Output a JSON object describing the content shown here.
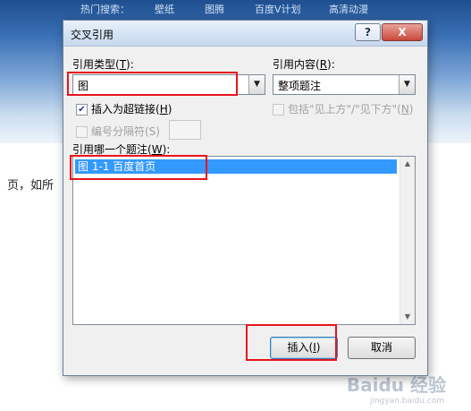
{
  "background": {
    "nav": [
      "热门搜索：",
      "壁纸",
      "图腾",
      "百度V计划",
      "高清动漫"
    ],
    "body_text": "页，如所"
  },
  "watermark": {
    "brand": "Baidu 经验",
    "url": "jingyan.baidu.com"
  },
  "dialog": {
    "title": "交叉引用",
    "help_button": "?",
    "close_button": "X",
    "reference_type": {
      "label_prefix": "引用类型(",
      "label_key": "T",
      "label_suffix": "):",
      "value": "图"
    },
    "reference_content": {
      "label_prefix": "引用内容(",
      "label_key": "R",
      "label_suffix": "):",
      "value": "整项题注"
    },
    "insert_hyperlink": {
      "label_prefix": "插入为超链接(",
      "label_key": "H",
      "label_suffix": ")",
      "checked": true
    },
    "include_above_below": {
      "label_prefix": "包括\"见上方\"/\"见下方\"(",
      "label_key": "N",
      "label_suffix": ")",
      "checked": false
    },
    "separate_numbers": {
      "label": "编号分隔符(S)",
      "checked": false
    },
    "for_which_caption": {
      "label_prefix": "引用哪一个题注(",
      "label_key": "W",
      "label_suffix": "):"
    },
    "captions": [
      "图 1-1 百度首页"
    ],
    "insert_button": {
      "label_prefix": "插入(",
      "label_key": "I",
      "label_suffix": ")"
    },
    "cancel_button": "取消"
  },
  "colors": {
    "highlight": "#e8141c",
    "selection": "#3399ff"
  }
}
